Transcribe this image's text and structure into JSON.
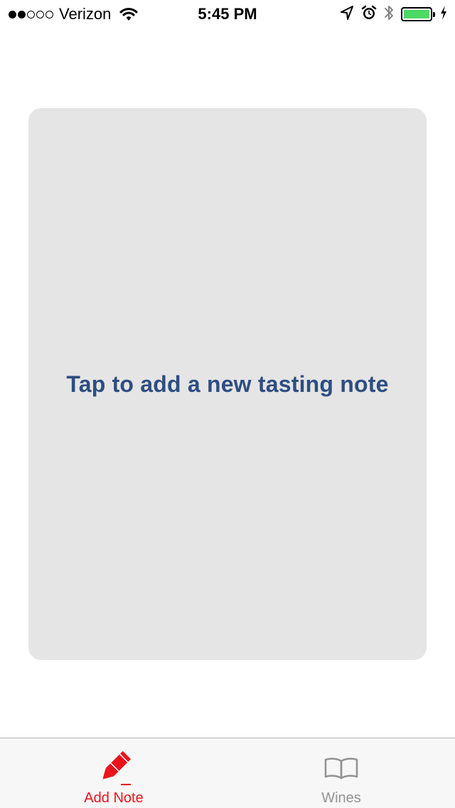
{
  "status_bar": {
    "signal_filled": 2,
    "signal_total": 5,
    "carrier": "Verizon",
    "time": "5:45 PM",
    "battery_level": 1.0,
    "battery_color": "#4cd964",
    "icons": [
      "wifi-icon",
      "location-arrow-icon",
      "alarm-clock-icon",
      "bluetooth-icon",
      "battery-icon",
      "charging-bolt-icon"
    ]
  },
  "card": {
    "prompt": "Tap to add a new tasting note",
    "background": "#e5e5e5",
    "text_color": "#2e4e82"
  },
  "tab_bar": {
    "active_color": "#e8141b",
    "inactive_color": "#929292",
    "tabs": [
      {
        "label": "Add Note",
        "icon": "pencil-icon",
        "selected": true
      },
      {
        "label": "Wines",
        "icon": "book-icon",
        "selected": false
      }
    ]
  }
}
